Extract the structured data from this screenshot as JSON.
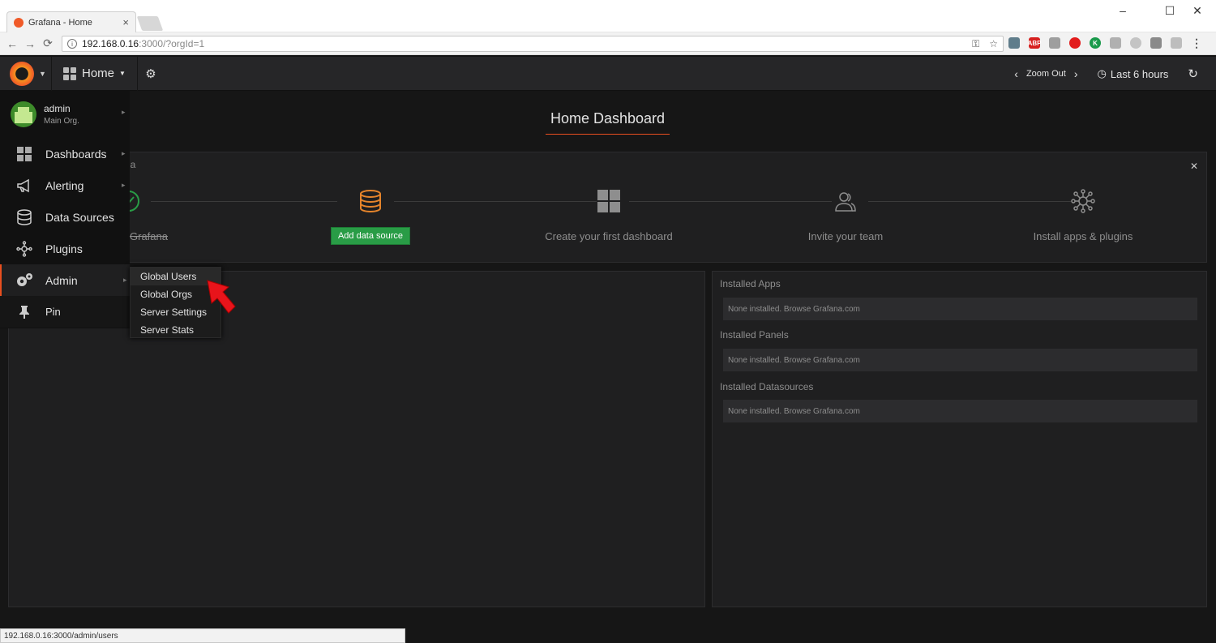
{
  "browser": {
    "tab_title": "Grafana - Home",
    "tab_close": "×",
    "url_host": "192.168.0.16",
    "url_rest": ":3000/?orgId=1",
    "status_url": "192.168.0.16:3000/admin/users",
    "ext_abp": "ABP",
    "ext_k": "K"
  },
  "navbar": {
    "home_label": "Home",
    "zoom_out": "Zoom Out",
    "time_range": "Last 6 hours"
  },
  "sidemenu": {
    "user": "admin",
    "org": "Main Org.",
    "items": [
      {
        "label": "Dashboards"
      },
      {
        "label": "Alerting"
      },
      {
        "label": "Data Sources"
      },
      {
        "label": "Plugins"
      },
      {
        "label": "Admin"
      },
      {
        "label": "Pin"
      }
    ],
    "admin_submenu": [
      {
        "label": "Global Users"
      },
      {
        "label": "Global Orgs"
      },
      {
        "label": "Server Settings"
      },
      {
        "label": "Server Stats"
      }
    ]
  },
  "dashboard": {
    "title": "Home Dashboard",
    "getting_started": {
      "title_fragment": "na",
      "steps": [
        {
          "label": "Grafana"
        },
        {
          "button": "Add data source"
        },
        {
          "label": "Create your first dashboard"
        },
        {
          "label": "Invite your team"
        },
        {
          "label": "Install apps & plugins"
        }
      ]
    },
    "plugins": {
      "apps_title": "Installed Apps",
      "apps_empty": "None installed. Browse Grafana.com",
      "panels_title": "Installed Panels",
      "panels_empty": "None installed. Browse Grafana.com",
      "datasources_title": "Installed Datasources",
      "datasources_empty": "None installed. Browse Grafana.com"
    }
  },
  "colors": {
    "accent": "#e94f1f",
    "success": "#299c46",
    "step_orange": "#e5842b",
    "arrow_red": "#e8141b"
  }
}
